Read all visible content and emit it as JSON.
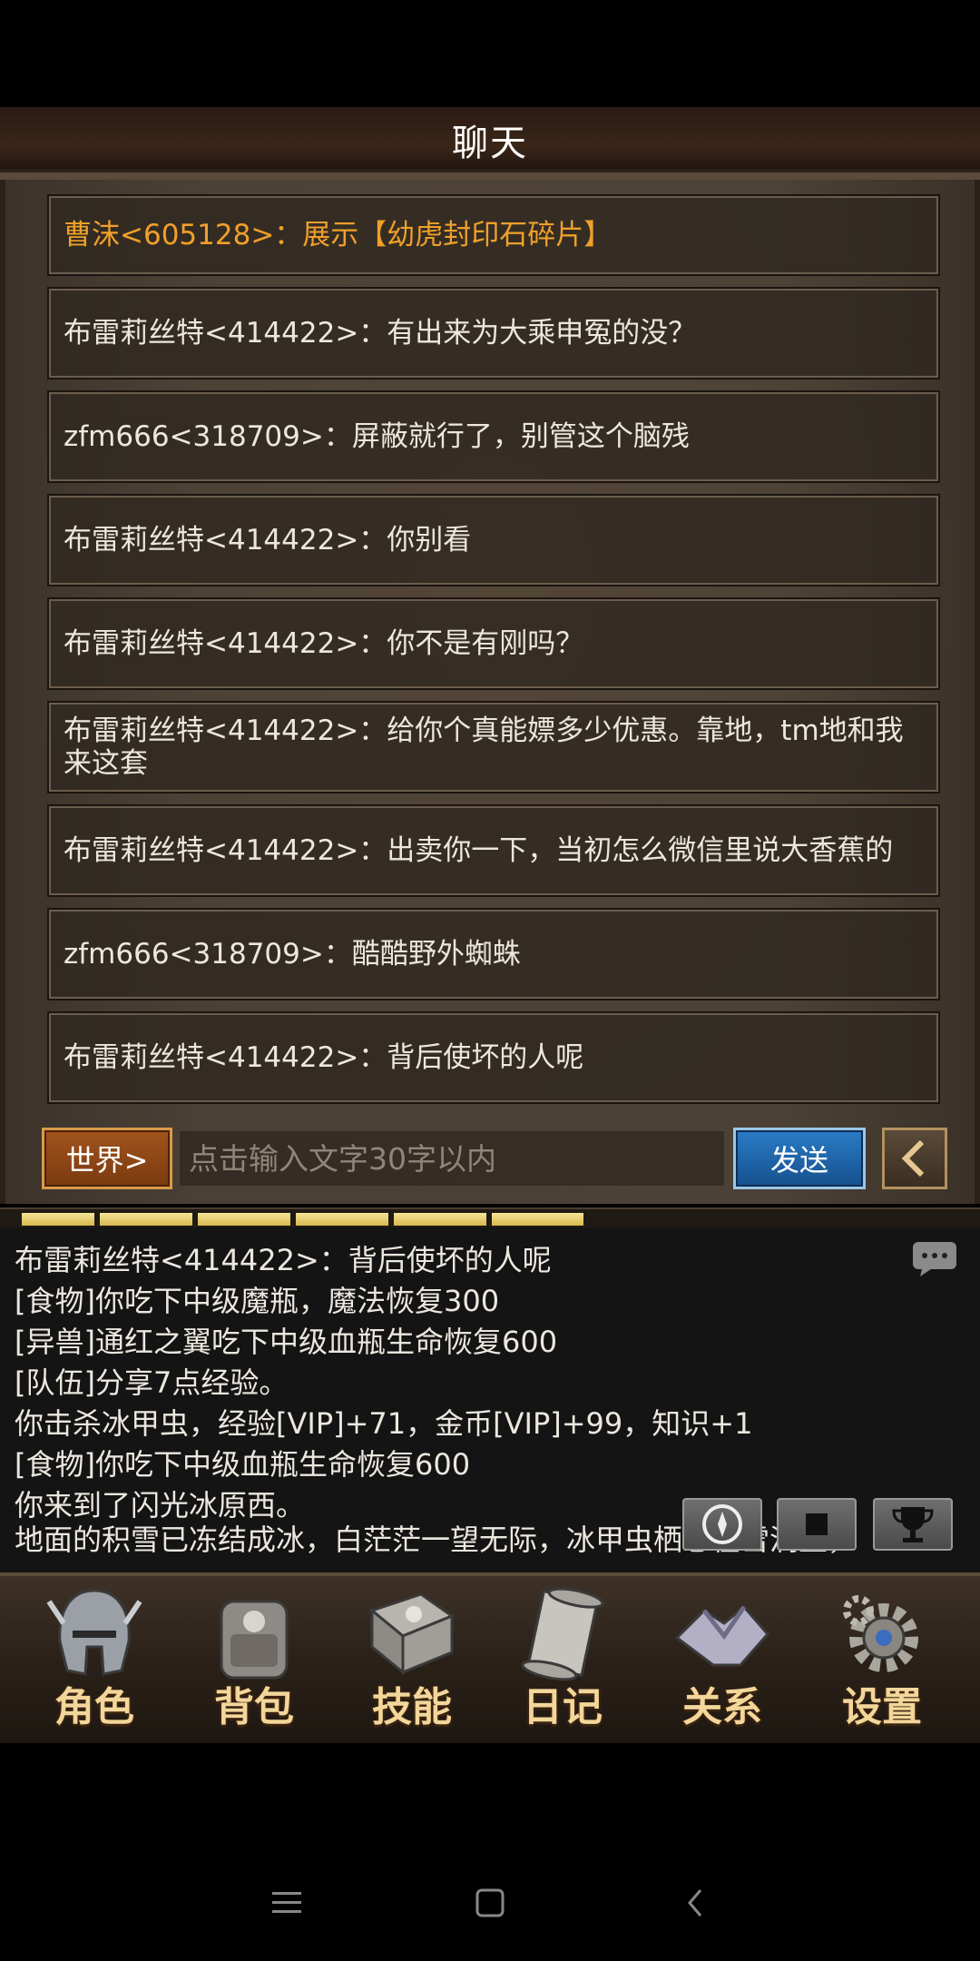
{
  "header": {
    "title": "聊天"
  },
  "messages": [
    {
      "text": "曹沫<605128>：展示【幼虎封印石碎片】",
      "highlight": true
    },
    {
      "text": "布雷莉丝特<414422>：有出来为大乘申冤的没？"
    },
    {
      "text": "zfm666<318709>：屏蔽就行了，别管这个脑残"
    },
    {
      "text": "布雷莉丝特<414422>：你别看"
    },
    {
      "text": "布雷莉丝特<414422>：你不是有刚吗？"
    },
    {
      "text": "布雷莉丝特<414422>：给你个真能嫖多少优惠。靠地，tm地和我来这套"
    },
    {
      "text": "布雷莉丝特<414422>：出卖你一下，当初怎么微信里说大香蕉的"
    },
    {
      "text": "zfm666<318709>：酷酷野外蜘蛛"
    },
    {
      "text": "布雷莉丝特<414422>：背后使坏的人呢"
    }
  ],
  "input": {
    "channel_label": "世界>",
    "placeholder": "点击输入文字30字以内",
    "send_label": "发送",
    "back_icon": "chevron-left-icon"
  },
  "xp_progress": 0.6,
  "log": [
    "布雷莉丝特<414422>：背后使坏的人呢",
    "[食物]你吃下中级魔瓶，魔法恢复300",
    "[异兽]通红之翼吃下中级血瓶生命恢复600",
    "[队伍]分享7点经验。",
    "你击杀冰甲虫，经验[VIP]+71，金币[VIP]+99，知识+1",
    "[食物]你吃下中级血瓶生命恢复600",
    "你来到了闪光冰原西。",
    "地面的积雪已冻结成冰，白茫茫一望无际，冰甲虫栖息在雪洞里，"
  ],
  "tools": [
    "compass-icon",
    "stop-icon",
    "trophy-icon"
  ],
  "nav": [
    {
      "label": "角色",
      "icon": "helmet-icon"
    },
    {
      "label": "背包",
      "icon": "backpack-icon"
    },
    {
      "label": "技能",
      "icon": "spellbook-icon"
    },
    {
      "label": "日记",
      "icon": "scroll-icon"
    },
    {
      "label": "关系",
      "icon": "handshake-icon"
    },
    {
      "label": "设置",
      "icon": "gear-icon"
    }
  ],
  "system_nav": [
    "menu-icon",
    "home-icon",
    "back-icon"
  ],
  "colors": {
    "highlight": "#f0a02a",
    "text": "#ece7df",
    "label_gold": "#f3d69a"
  }
}
